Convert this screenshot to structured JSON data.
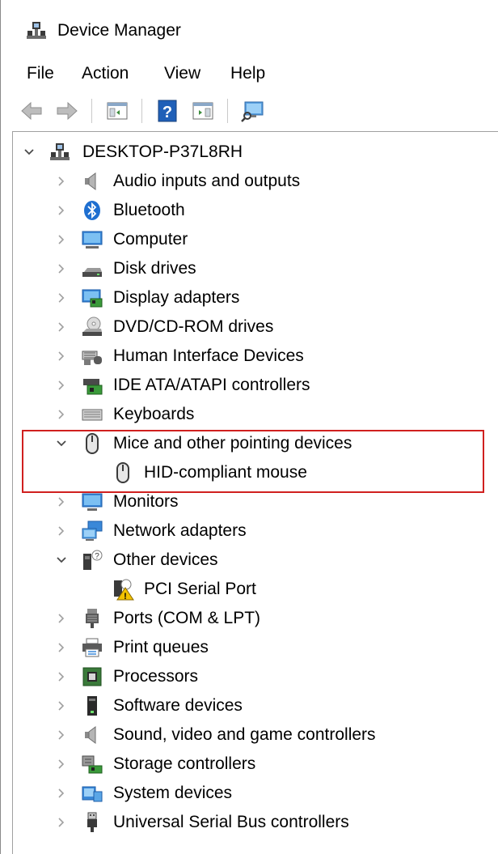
{
  "window": {
    "title": "Device Manager"
  },
  "menu": [
    {
      "label": "File"
    },
    {
      "label": "Action"
    },
    {
      "label": "View"
    },
    {
      "label": "Help"
    }
  ],
  "toolbar": {
    "buttons": [
      "back-icon",
      "forward-icon",
      "properties-pane-icon",
      "help-icon",
      "action-pane-icon",
      "scan-hardware-icon"
    ]
  },
  "tree": {
    "root": {
      "label": "DESKTOP-P37L8RH",
      "expanded": true
    },
    "items": [
      {
        "label": "Audio inputs and outputs",
        "icon": "speaker-icon",
        "expanded": false
      },
      {
        "label": "Bluetooth",
        "icon": "bluetooth-icon",
        "expanded": false
      },
      {
        "label": "Computer",
        "icon": "computer-icon",
        "expanded": false
      },
      {
        "label": "Disk drives",
        "icon": "disk-drive-icon",
        "expanded": false
      },
      {
        "label": "Display adapters",
        "icon": "display-adapter-icon",
        "expanded": false
      },
      {
        "label": "DVD/CD-ROM drives",
        "icon": "dvd-drive-icon",
        "expanded": false
      },
      {
        "label": "Human Interface Devices",
        "icon": "hid-icon",
        "expanded": false
      },
      {
        "label": "IDE ATA/ATAPI controllers",
        "icon": "ide-controller-icon",
        "expanded": false
      },
      {
        "label": "Keyboards",
        "icon": "keyboard-icon",
        "expanded": false
      },
      {
        "label": "Mice and other pointing devices",
        "icon": "mouse-icon",
        "expanded": true,
        "children": [
          {
            "label": "HID-compliant mouse",
            "icon": "mouse-icon"
          }
        ]
      },
      {
        "label": "Monitors",
        "icon": "monitor-icon",
        "expanded": false
      },
      {
        "label": "Network adapters",
        "icon": "network-adapter-icon",
        "expanded": false
      },
      {
        "label": "Other devices",
        "icon": "other-devices-icon",
        "expanded": true,
        "children": [
          {
            "label": "PCI Serial Port",
            "icon": "warning-device-icon"
          }
        ]
      },
      {
        "label": "Ports (COM & LPT)",
        "icon": "port-icon",
        "expanded": false
      },
      {
        "label": "Print queues",
        "icon": "printer-icon",
        "expanded": false
      },
      {
        "label": "Processors",
        "icon": "processor-icon",
        "expanded": false
      },
      {
        "label": "Software devices",
        "icon": "software-device-icon",
        "expanded": false
      },
      {
        "label": "Sound, video and game controllers",
        "icon": "sound-controller-icon",
        "expanded": false
      },
      {
        "label": "Storage controllers",
        "icon": "storage-controller-icon",
        "expanded": false
      },
      {
        "label": "System devices",
        "icon": "system-devices-icon",
        "expanded": false
      },
      {
        "label": "Universal Serial Bus controllers",
        "icon": "usb-icon",
        "expanded": false
      }
    ]
  },
  "colors": {
    "highlight_border": "#d0201f",
    "accent_blue": "#1f6fd0"
  }
}
